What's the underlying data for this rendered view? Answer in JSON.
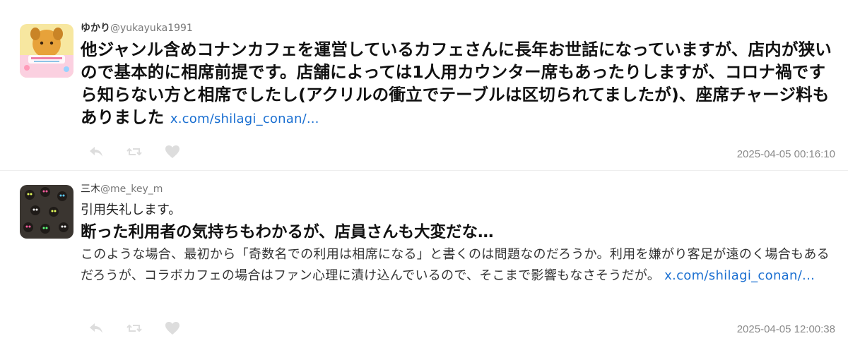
{
  "tweets": [
    {
      "display_name": "ゆかり",
      "screen_name": "@yukayuka1991",
      "text": "他ジャンル含めコナンカフェを運営しているカフェさんに長年お世話になっていますが、店内が狭いので基本的に相席前提です。店舗によっては1人用カウンター席もあったりしますが、コロナ禍ですら知らない方と相席でしたし(アクリルの衝立でテーブルは区切られてましたが)、座席チャージ料もありました",
      "link": "x.com/shilagi_conan/...",
      "timestamp": "2025-04-05 00:16:10",
      "icons": {
        "reply": "reply-icon",
        "retweet": "retweet-icon",
        "like": "heart-icon"
      }
    },
    {
      "display_name": "三木",
      "screen_name": "@me_key_m",
      "intro": "引用失礼します。",
      "headline": "断った利用者の気持ちもわかるが、店員さんも大変だな…",
      "text": "このような場合、最初から「奇数名での利用は相席になる」と書くのは問題なのだろうか。利用を嫌がり客足が遠のく場合もあるだろうが、コラボカフェの場合はファン心理に漬け込んでいるので、そこまで影響もなさそうだが。",
      "link": "x.com/shilagi_conan/...",
      "timestamp": "2025-04-05 12:00:38",
      "icons": {
        "reply": "reply-icon",
        "retweet": "retweet-icon",
        "like": "heart-icon"
      }
    }
  ],
  "colors": {
    "link": "#1a6fd1",
    "action_icon": "#dddddd",
    "timestamp": "#8a8a8a",
    "divider": "#eeeeee"
  }
}
